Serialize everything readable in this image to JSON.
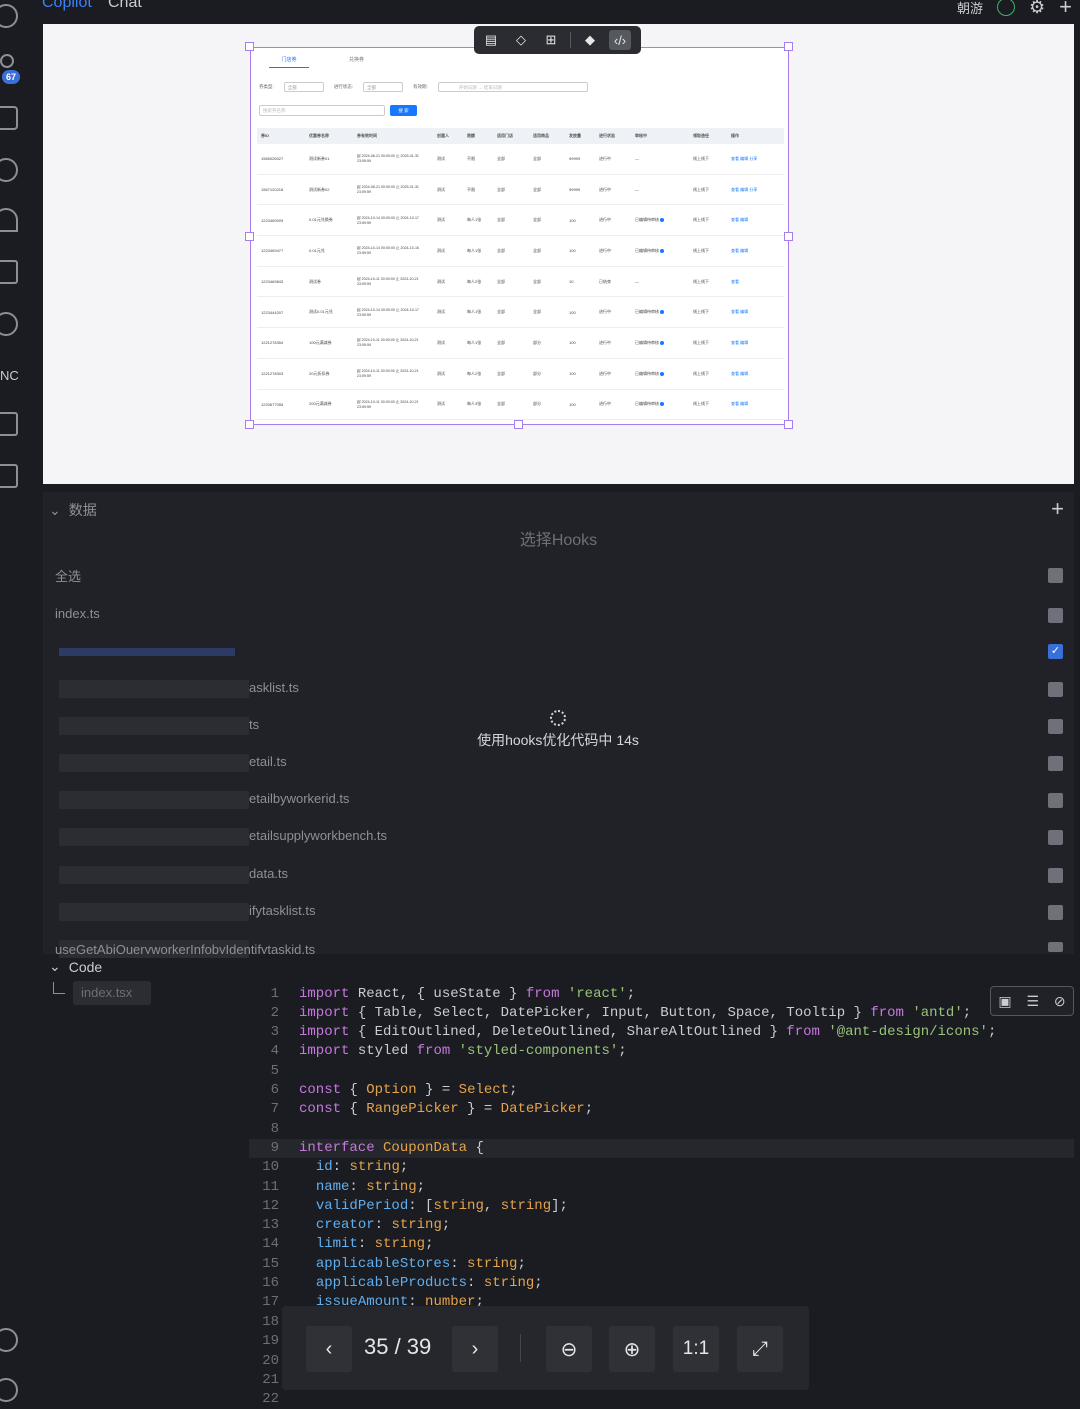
{
  "topbar": {
    "tabs": [
      "Copilot",
      "Chat"
    ],
    "user_name": "朝游",
    "icons": [
      "avatar-icon",
      "settings-icon",
      "plus-icon"
    ]
  },
  "sidebar": {
    "badge": "67",
    "label_nc": "NC",
    "icons": [
      "search-icon",
      "users-icon",
      "history-icon",
      "cube-icon",
      "headphones-icon",
      "share-icon",
      "refresh-icon",
      "grid-icon",
      "sparkle-icon",
      "account-icon",
      "settings-icon"
    ]
  },
  "float_toolbar": {
    "buttons": [
      "layout-icon",
      "component-icon",
      "frame-icon",
      "gem-icon",
      "code-icon"
    ]
  },
  "mini_preview": {
    "tabs": [
      "门店券",
      "兑换券"
    ],
    "filters": [
      {
        "label": "券类型:",
        "value": "全部"
      },
      {
        "label": "进行状态:",
        "value": "全部"
      },
      {
        "label": "有效期:",
        "value": "开始日期 → 结束日期"
      }
    ],
    "search_placeholder": "搜索券名称",
    "search_button": "搜 索",
    "columns": [
      "券ID",
      "优惠券名称",
      "券有效时间",
      "创建人",
      "限额",
      "适用门店",
      "适用商品",
      "发放量",
      "进行状态",
      "审核中",
      "领取途径",
      "操作"
    ],
    "rows": [
      [
        "1565026027",
        "测试新券01",
        "起 2024-08-21 00:00:00 止 2025-01-31 23:59:59",
        "测试",
        "不限",
        "全部",
        "全部",
        "99999",
        "进行中",
        "—",
        "线上线下",
        "查看 编辑 分享"
      ],
      [
        "1567120218",
        "测试新券02",
        "起 2024-08-21 00:00:00 止 2025-01-31 23:59:59",
        "测试",
        "不限",
        "全部",
        "全部",
        "99999",
        "进行中",
        "—",
        "线上线下",
        "查看 编辑 分享"
      ],
      [
        "1223469009",
        "0.01元兑换券",
        "起 2024-10-14 00:00:00 止 2024-10-17 23:59:59",
        "测试",
        "每人1张",
        "全部",
        "全部",
        "100",
        "进行中",
        "已编辑待审核",
        "线上线下",
        "查看 编辑"
      ],
      [
        "1223469477",
        "0.01元兑",
        "起 2024-10-14 00:00:00 止 2024-10-16 23:59:59",
        "测试",
        "每人1张",
        "全部",
        "全部",
        "100",
        "进行中",
        "已编辑待审核",
        "线上线下",
        "查看 编辑"
      ],
      [
        "1223469843",
        "测试券",
        "起 2024-10-11 00:00:00 止 2024-10-21 23:59:59",
        "测试",
        "每人2张",
        "全部",
        "全部",
        "10",
        "已结束",
        "—",
        "线上线下",
        "查看"
      ],
      [
        "1223444207",
        "测试0.01元兑",
        "起 2024-10-14 00:00:00 止 2024-10-17 23:59:59",
        "测试",
        "每人1张",
        "全部",
        "全部",
        "100",
        "进行中",
        "已编辑待审核",
        "线上线下",
        "查看 编辑"
      ],
      [
        "1221278354",
        "100元满减券",
        "起 2024-10-11 00:00:00 止 2024-10-21 23:59:59",
        "测试",
        "每人1张",
        "全部",
        "部分",
        "100",
        "进行中",
        "已编辑待审核",
        "线上线下",
        "查看 编辑"
      ],
      [
        "1221278303",
        "20元折扣券",
        "起 2024-10-11 00:00:00 止 2024-10-21 23:59:59",
        "测试",
        "每人2张",
        "全部",
        "部分",
        "100",
        "进行中",
        "已编辑待审核",
        "线上线下",
        "查看 编辑"
      ],
      [
        "1220677055",
        "200元满减券",
        "起 2024-10-11 00:00:00 止 2024-10-21 23:59:59",
        "测试",
        "每人3张",
        "全部",
        "部分",
        "100",
        "进行中",
        "已编辑待审核",
        "线上线下",
        "查看 编辑"
      ]
    ]
  },
  "data_panel": {
    "header": "数据",
    "title": "选择Hooks",
    "select_all": "全选",
    "hooks": [
      {
        "label": "index.ts",
        "checked": false
      },
      {
        "label": "",
        "checked": true
      },
      {
        "label": "asklist.ts",
        "checked": false
      },
      {
        "label": "ts",
        "checked": false
      },
      {
        "label": "etail.ts",
        "checked": false
      },
      {
        "label": "etailbyworkerid.ts",
        "checked": false
      },
      {
        "label": "etailsupplyworkbench.ts",
        "checked": false
      },
      {
        "label": "data.ts",
        "checked": false
      },
      {
        "label": "ifytasklist.ts",
        "checked": false
      },
      {
        "label": "useGetAbiQueryworkerInfobyIdentifytaskid.ts",
        "checked": false
      }
    ],
    "loading_text": "使用hooks优化代码中 14s"
  },
  "code_panel": {
    "header": "Code",
    "file": "index.tsx",
    "tool_icons": [
      "preview-icon",
      "notes-icon",
      "hide-icon"
    ]
  },
  "viewer": {
    "counter": "35 / 39",
    "ratio": "1:1",
    "icons": [
      "prev-icon",
      "next-icon",
      "zoom-out-icon",
      "zoom-in-icon",
      "fullscreen-icon"
    ]
  }
}
